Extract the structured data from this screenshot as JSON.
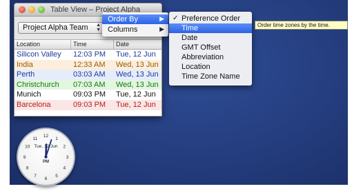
{
  "window": {
    "title": "Table View – Project Alpha",
    "team_select": {
      "value": "Project Alpha Team"
    }
  },
  "table": {
    "columns": [
      "Location",
      "Time",
      "Date"
    ],
    "rows": [
      {
        "location": "Silicon Valley",
        "time": "12:03 PM",
        "date": "Tue, 12 Jun",
        "text_color": "#1c3a9a",
        "bg": "#ffffff"
      },
      {
        "location": "India",
        "time": "12:33 AM",
        "date": "Wed, 13 Jun",
        "text_color": "#9a5a00",
        "bg": "#fbeedd"
      },
      {
        "location": "Perth",
        "time": "03:03 AM",
        "date": "Wed, 13 Jun",
        "text_color": "#1c3a9a",
        "bg": "#e6edfa"
      },
      {
        "location": "Christchurch",
        "time": "07:03 AM",
        "date": "Wed, 13 Jun",
        "text_color": "#16741c",
        "bg": "#e3f6df"
      },
      {
        "location": "Munich",
        "time": "09:03 PM",
        "date": "Tue, 12 Jun",
        "text_color": "#111111",
        "bg": "#ffffff"
      },
      {
        "location": "Barcelona",
        "time": "09:03 PM",
        "date": "Tue, 12 Jun",
        "text_color": "#b31d1d",
        "bg": "#fbe6e6"
      }
    ]
  },
  "context_menu": {
    "items": [
      {
        "label": "Order By",
        "has_submenu": true,
        "highlighted": true
      },
      {
        "label": "Columns",
        "has_submenu": true,
        "highlighted": false
      }
    ]
  },
  "order_by_submenu": {
    "items": [
      {
        "label": "Preference Order",
        "checked": true,
        "highlighted": false
      },
      {
        "label": "Time",
        "checked": false,
        "highlighted": true
      },
      {
        "label": "Date",
        "checked": false,
        "highlighted": false
      },
      {
        "label": "GMT Offset",
        "checked": false,
        "highlighted": false
      },
      {
        "label": "Abbreviation",
        "checked": false,
        "highlighted": false
      },
      {
        "label": "Location",
        "checked": false,
        "highlighted": false
      },
      {
        "label": "Time Zone Name",
        "checked": false,
        "highlighted": false
      }
    ],
    "check_glyph": "✓"
  },
  "tooltip": {
    "text": "Order time zones by the time."
  },
  "clock": {
    "date_label": "Tue, 12 Jun",
    "ampm": "PM",
    "numerals": [
      "12",
      "1",
      "2",
      "3",
      "4",
      "5",
      "6",
      "7",
      "8",
      "9",
      "10",
      "11"
    ],
    "hour": 12,
    "minute": 3
  },
  "icons": {
    "submenu_arrow": "▶",
    "popup_arrows": "up-down-chevron-icon"
  },
  "colors": {
    "desktop": "#243d7e",
    "menu_highlight": "#2d63e6",
    "tooltip_bg": "#fffdc6"
  }
}
